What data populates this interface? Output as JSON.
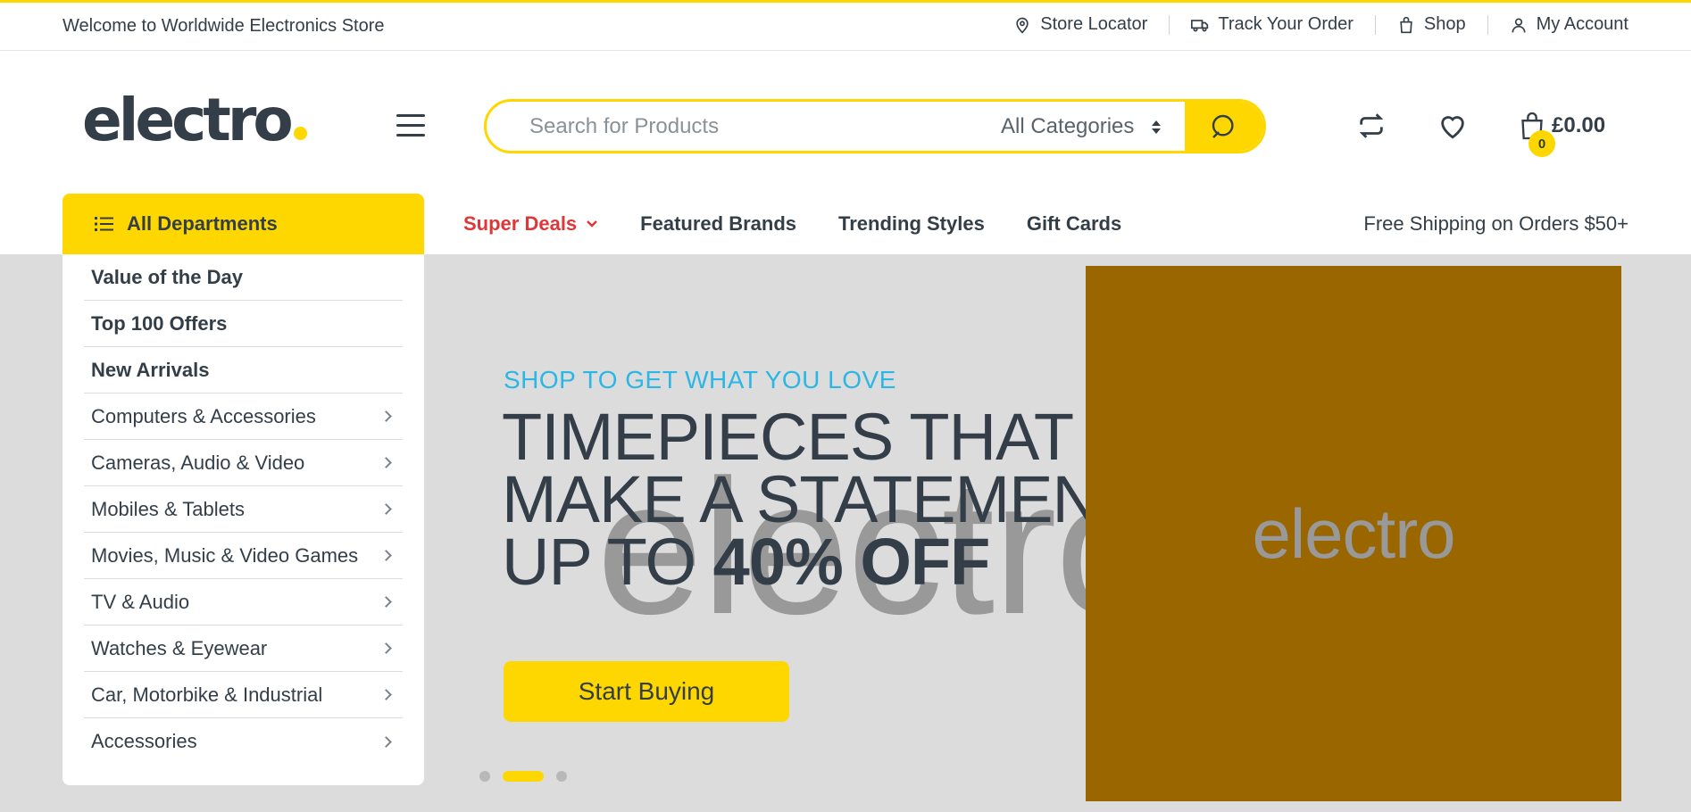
{
  "topbar": {
    "welcome": "Welcome to Worldwide Electronics Store",
    "links": [
      {
        "label": "Store Locator",
        "icon": "map-pin-icon"
      },
      {
        "label": "Track Your Order",
        "icon": "truck-icon"
      },
      {
        "label": "Shop",
        "icon": "shopping-bag-icon"
      },
      {
        "label": "My Account",
        "icon": "user-icon"
      }
    ]
  },
  "header": {
    "logo": "electro",
    "search": {
      "placeholder": "Search for Products",
      "category": "All Categories"
    },
    "cart": {
      "count": "0",
      "total": "£0.00"
    }
  },
  "nav": {
    "departments_label": "All Departments",
    "links": [
      "Super Deals",
      "Featured Brands",
      "Trending Styles",
      "Gift Cards"
    ],
    "free_shipping": "Free Shipping on Orders $50+"
  },
  "departments": [
    {
      "label": "Value of the Day"
    },
    {
      "label": "Top 100 Offers"
    },
    {
      "label": "New Arrivals"
    },
    {
      "label": "Computers & Accessories"
    },
    {
      "label": "Cameras, Audio & Video"
    },
    {
      "label": "Mobiles & Tablets"
    },
    {
      "label": "Movies, Music & Video Games"
    },
    {
      "label": "TV & Audio"
    },
    {
      "label": "Watches & Eyewear"
    },
    {
      "label": "Car, Motorbike & Industrial"
    },
    {
      "label": "Accessories"
    }
  ],
  "hero": {
    "subtitle": "SHOP TO GET WHAT YOU LOVE",
    "title_line1": "TIMEPIECES THAT",
    "title_line2": "MAKE A STATEMENT",
    "title_line3_prefix": "UP TO ",
    "title_line3_bold": "40% OFF",
    "watermark": "electro",
    "cta": "Start Buying",
    "image_text": "electro",
    "active_slide": 2,
    "slide_count": 3
  },
  "colors": {
    "accent": "#fed700",
    "text": "#333e48",
    "deals": "#df3737",
    "subtitle": "#2ab7e6",
    "hero_bg": "#dcdcdc",
    "image_bg": "#996600"
  }
}
